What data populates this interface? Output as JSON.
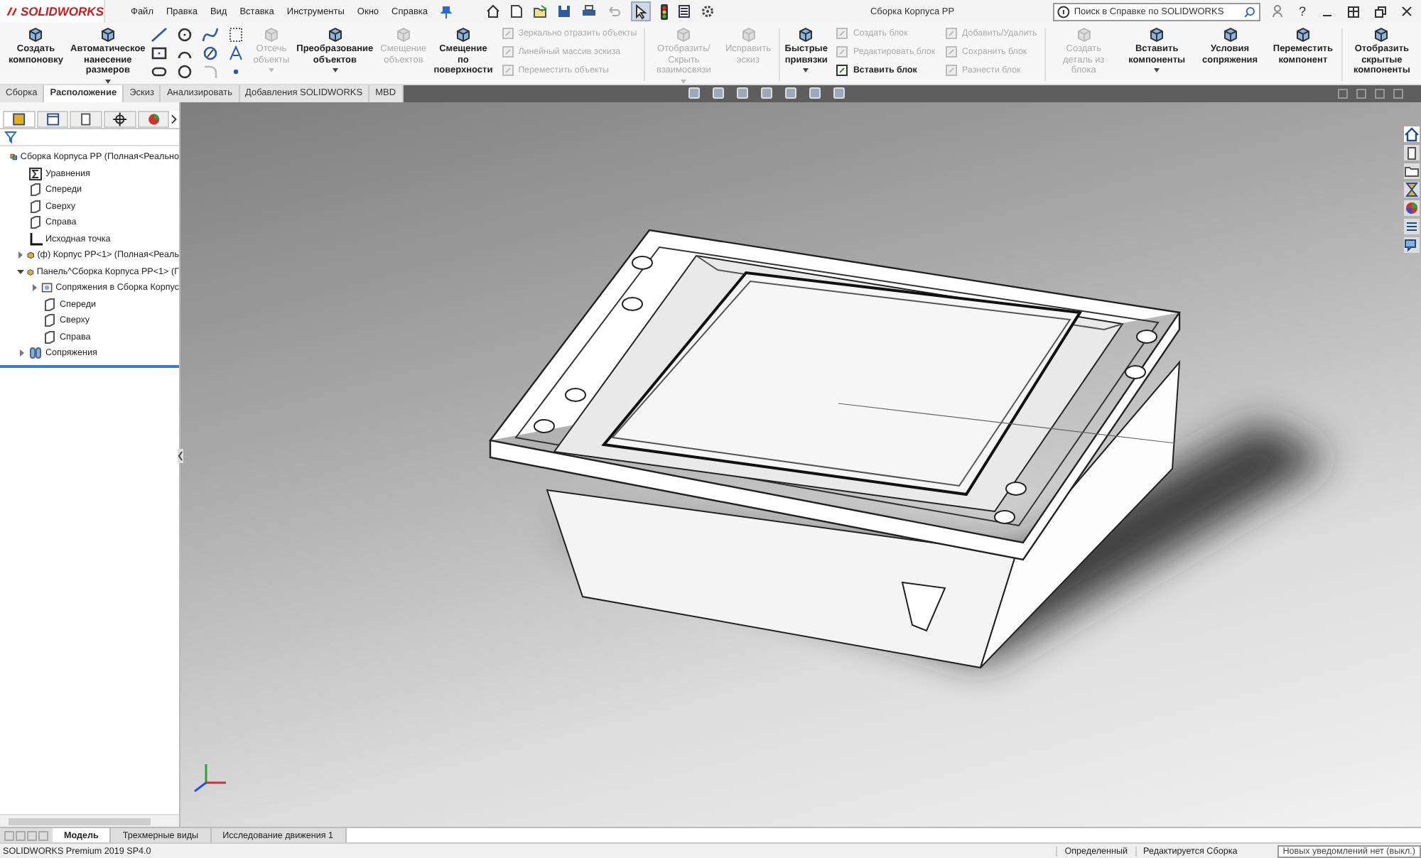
{
  "app": {
    "logo": "SOLIDWORKS"
  },
  "menu": [
    {
      "label": "Файл"
    },
    {
      "label": "Правка"
    },
    {
      "label": "Вид"
    },
    {
      "label": "Вставка"
    },
    {
      "label": "Инструменты"
    },
    {
      "label": "Окно"
    },
    {
      "label": "Справка"
    }
  ],
  "window": {
    "title": "Сборка Корпуса РР"
  },
  "search": {
    "placeholder": "Поиск в Справке по SOLIDWORKS"
  },
  "help": "?",
  "ribbon": [
    [
      {
        "kind": "large",
        "label": "Создать компоновку",
        "disabled": false,
        "dropdown": false
      },
      {
        "kind": "large",
        "label": "Автоматическое нанесение размеров",
        "disabled": false,
        "dropdown": true
      },
      {
        "kind": "sketch_tools"
      },
      {
        "kind": "large",
        "label": "Отсечь объекты",
        "disabled": true,
        "dropdown": true
      },
      {
        "kind": "large",
        "label": "Преобразование объектов",
        "disabled": false,
        "dropdown": true
      },
      {
        "kind": "large",
        "label": "Смещение объектов",
        "disabled": true,
        "dropdown": false
      },
      {
        "kind": "large",
        "label": "Смещение по поверхности",
        "disabled": false,
        "dropdown": false
      },
      {
        "kind": "stack",
        "items": [
          {
            "label": "Зеркально отразить объекты",
            "disabled": true
          },
          {
            "label": "Линейный массив эскиза",
            "disabled": true
          },
          {
            "label": "Переместить объекты",
            "disabled": true
          }
        ]
      }
    ],
    [
      {
        "kind": "large",
        "label": "Отобразить/Скрыть взаимосвязи",
        "disabled": true,
        "dropdown": true
      },
      {
        "kind": "large",
        "label": "Исправить эскиз",
        "disabled": true,
        "dropdown": false
      }
    ],
    [
      {
        "kind": "large",
        "label": "Быстрые привязки",
        "disabled": false,
        "dropdown": true
      },
      {
        "kind": "stack",
        "items": [
          {
            "label": "Создать блок",
            "disabled": true
          },
          {
            "label": "Редактировать блок",
            "disabled": true
          },
          {
            "label": "Вставить блок",
            "disabled": false
          }
        ]
      },
      {
        "kind": "stack",
        "items": [
          {
            "label": "Добавить/Удалить",
            "disabled": true
          },
          {
            "label": "Сохранить блок",
            "disabled": true
          },
          {
            "label": "Разнести блок",
            "disabled": true
          }
        ]
      }
    ],
    [
      {
        "kind": "large",
        "label": "Создать деталь из блока",
        "disabled": true,
        "dropdown": false
      },
      {
        "kind": "large",
        "label": "Вставить компоненты",
        "disabled": false,
        "dropdown": true
      },
      {
        "kind": "large",
        "label": "Условия сопряжения",
        "disabled": false,
        "dropdown": false
      },
      {
        "kind": "large",
        "label": "Переместить компонент",
        "disabled": false,
        "dropdown": false
      }
    ],
    [
      {
        "kind": "large",
        "label": "Отобразить скрытые компоненты",
        "disabled": false,
        "dropdown": false
      }
    ]
  ],
  "command_tabs": [
    {
      "label": "Сборка",
      "selected": false
    },
    {
      "label": "Расположение",
      "selected": true
    },
    {
      "label": "Эскиз",
      "selected": false
    },
    {
      "label": "Анализировать",
      "selected": false
    },
    {
      "label": "Добавления SOLIDWORKS",
      "selected": false
    },
    {
      "label": "MBD",
      "selected": false
    }
  ],
  "feature_tree": [
    {
      "label": "Сборка Корпуса РР  (Полная<Реально",
      "kind": "assembly",
      "children": [
        {
          "label": "Уравнения",
          "kind": "equations"
        },
        {
          "label": "Спереди",
          "kind": "plane"
        },
        {
          "label": "Сверху",
          "kind": "plane"
        },
        {
          "label": "Справа",
          "kind": "plane"
        },
        {
          "label": "Исходная точка",
          "kind": "origin"
        },
        {
          "label": "(ф) Корпус РР<1> (Полная<Реаль",
          "kind": "part",
          "expanded": false
        },
        {
          "label": "Панель^Сборка Корпуса РР<1> (Г",
          "kind": "part",
          "expanded": true,
          "children": [
            {
              "label": "Сопряжения в Сборка Корпус",
              "kind": "mate_folder",
              "expanded": false
            },
            {
              "label": "Спереди",
              "kind": "plane"
            },
            {
              "label": "Сверху",
              "kind": "plane"
            },
            {
              "label": "Справа",
              "kind": "plane"
            }
          ]
        },
        {
          "label": "Сопряжения",
          "kind": "mates",
          "expanded": false
        }
      ]
    }
  ],
  "bottom_tabs": [
    {
      "label": "Модель",
      "selected": true
    },
    {
      "label": "Трехмерные виды",
      "selected": false
    },
    {
      "label": "Исследование движения 1",
      "selected": false
    }
  ],
  "status_bar": {
    "product": "SOLIDWORKS Premium 2019 SP4.0",
    "state": "Определенный",
    "mode": "Редактируется Сборка",
    "notifications": "Новых уведомлений нет (выкл.)"
  }
}
